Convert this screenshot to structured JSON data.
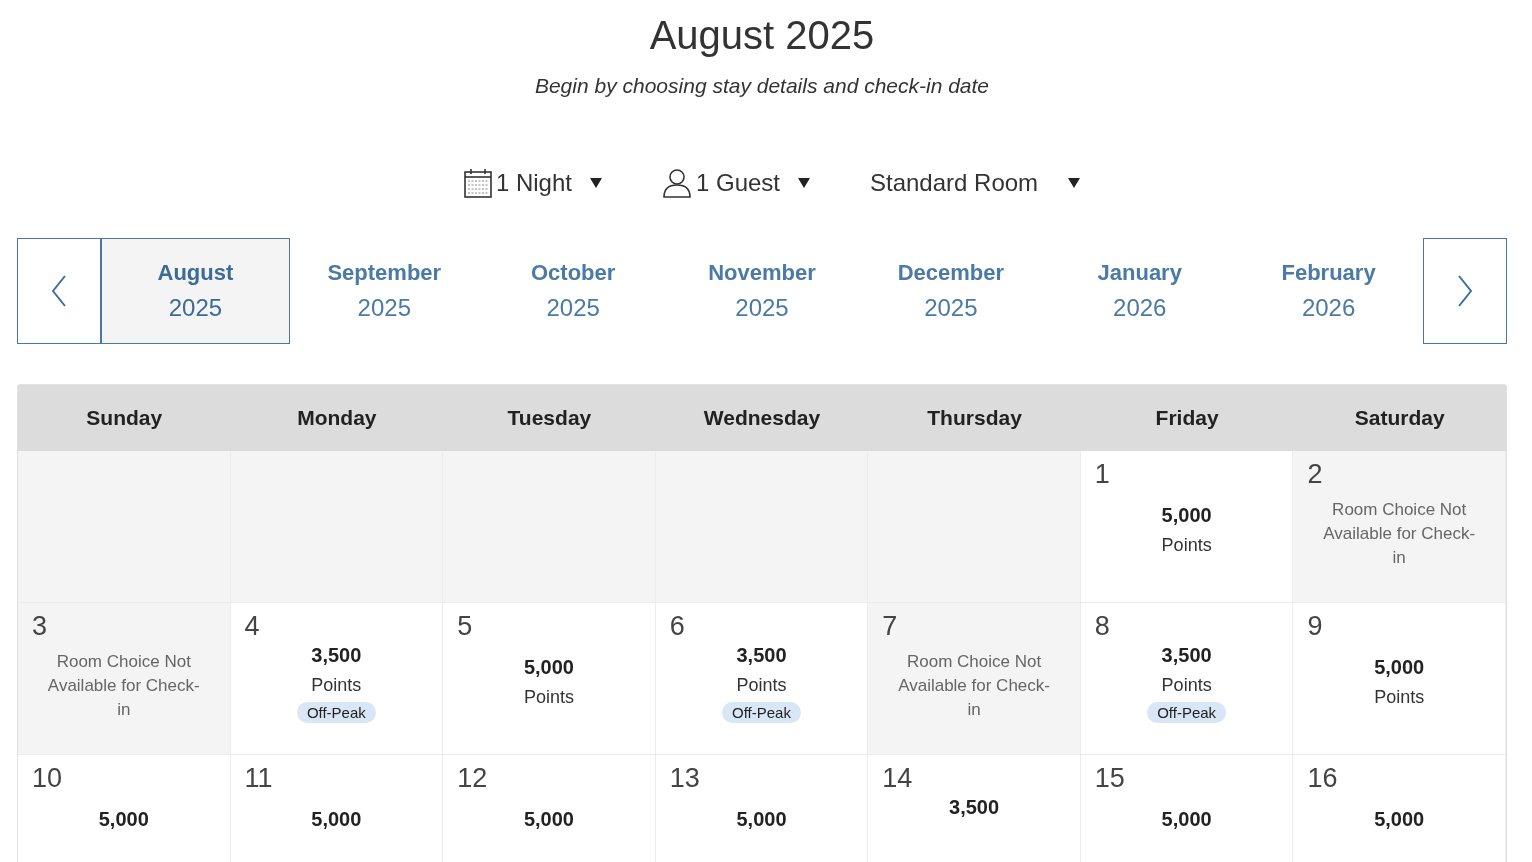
{
  "title": "August 2025",
  "subtitle": "Begin by choosing stay details and check-in date",
  "selectors": [
    {
      "kind": "calendar",
      "label": "1 Night"
    },
    {
      "kind": "person",
      "label": "1 Guest"
    },
    {
      "kind": "plain",
      "label": "Standard Room"
    }
  ],
  "months": [
    {
      "month": "August",
      "year": "2025",
      "selected": true
    },
    {
      "month": "September",
      "year": "2025",
      "selected": false
    },
    {
      "month": "October",
      "year": "2025",
      "selected": false
    },
    {
      "month": "November",
      "year": "2025",
      "selected": false
    },
    {
      "month": "December",
      "year": "2025",
      "selected": false
    },
    {
      "month": "January",
      "year": "2026",
      "selected": false
    },
    {
      "month": "February",
      "year": "2026",
      "selected": false
    }
  ],
  "weekdays": [
    "Sunday",
    "Monday",
    "Tuesday",
    "Wednesday",
    "Thursday",
    "Friday",
    "Saturday"
  ],
  "weeks": [
    [
      {
        "kind": "empty"
      },
      {
        "kind": "empty"
      },
      {
        "kind": "empty"
      },
      {
        "kind": "empty"
      },
      {
        "kind": "empty"
      },
      {
        "kind": "points",
        "day": "1",
        "points": "5,000",
        "unit": "Points",
        "off_peak": false
      },
      {
        "kind": "unavailable",
        "day": "2",
        "note": "Room Choice Not Available for Check-in"
      }
    ],
    [
      {
        "kind": "unavailable",
        "day": "3",
        "note": "Room Choice Not Available for Check-in"
      },
      {
        "kind": "points",
        "day": "4",
        "points": "3,500",
        "unit": "Points",
        "off_peak": true,
        "badge": "Off-Peak"
      },
      {
        "kind": "points",
        "day": "5",
        "points": "5,000",
        "unit": "Points",
        "off_peak": false
      },
      {
        "kind": "points",
        "day": "6",
        "points": "3,500",
        "unit": "Points",
        "off_peak": true,
        "badge": "Off-Peak"
      },
      {
        "kind": "unavailable",
        "day": "7",
        "note": "Room Choice Not Available for Check-in"
      },
      {
        "kind": "points",
        "day": "8",
        "points": "3,500",
        "unit": "Points",
        "off_peak": true,
        "badge": "Off-Peak"
      },
      {
        "kind": "points",
        "day": "9",
        "points": "5,000",
        "unit": "Points",
        "off_peak": false
      }
    ],
    [
      {
        "kind": "points",
        "day": "10",
        "points": "5,000",
        "off_peak": false
      },
      {
        "kind": "points",
        "day": "11",
        "points": "5,000",
        "off_peak": false
      },
      {
        "kind": "points",
        "day": "12",
        "points": "5,000",
        "off_peak": false
      },
      {
        "kind": "points",
        "day": "13",
        "points": "5,000",
        "off_peak": false
      },
      {
        "kind": "points",
        "day": "14",
        "points": "3,500",
        "off_peak": true
      },
      {
        "kind": "points",
        "day": "15",
        "points": "5,000",
        "off_peak": false
      },
      {
        "kind": "points",
        "day": "16",
        "points": "5,000",
        "off_peak": false
      }
    ]
  ]
}
